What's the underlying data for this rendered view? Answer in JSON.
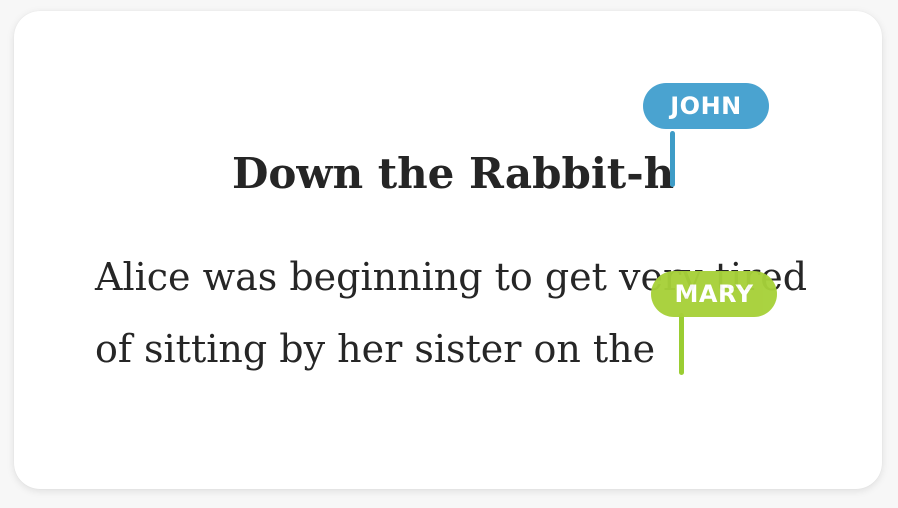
{
  "document": {
    "title": "Down the Rabbit-h",
    "body_lines": [
      "Alice was beginning to get very tired",
      "of sitting by her sister on the"
    ]
  },
  "cursors": [
    {
      "name": "JOHN",
      "color": "#4aa3d0"
    },
    {
      "name": "MARY",
      "color": "#a7d139"
    }
  ]
}
